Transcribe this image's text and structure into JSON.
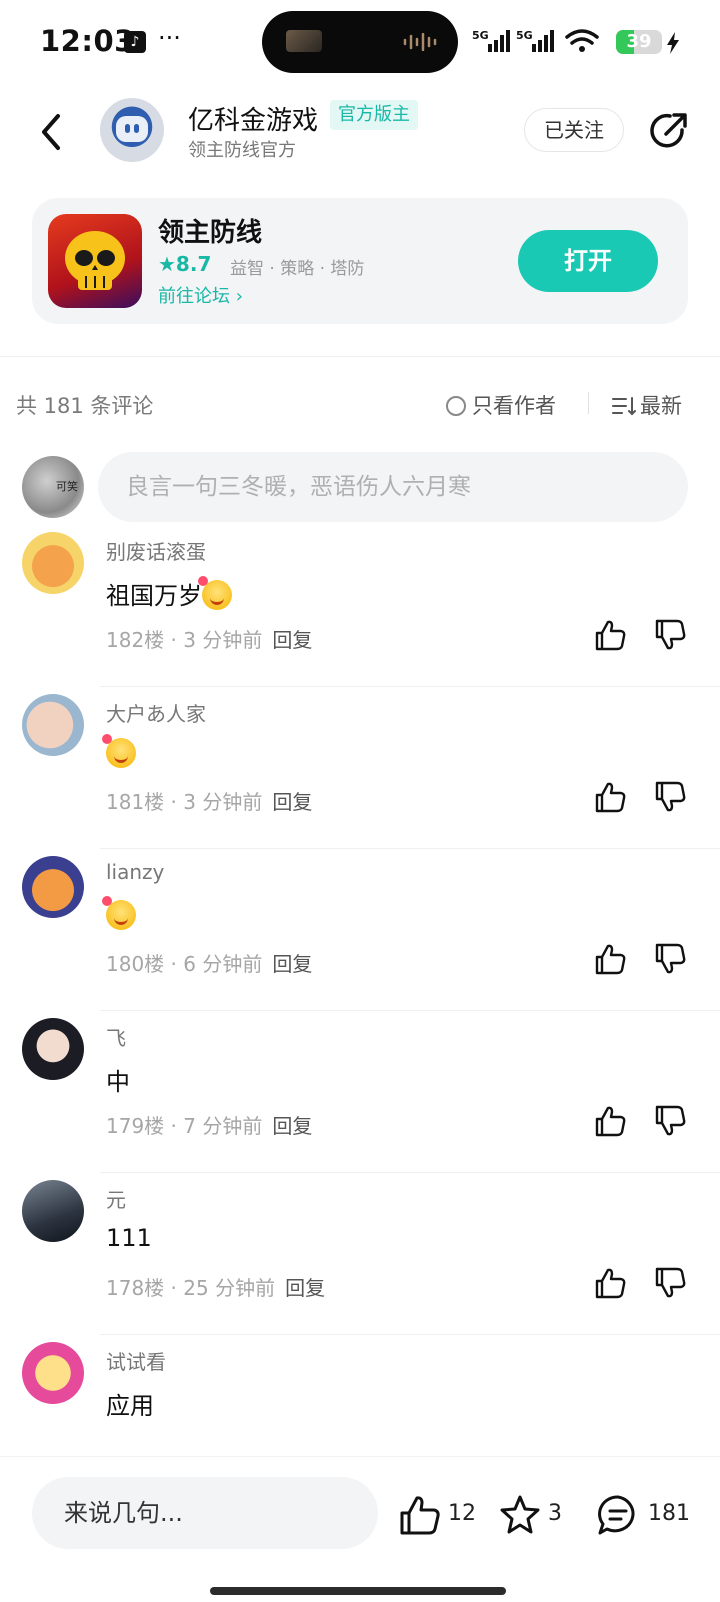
{
  "status_bar": {
    "time": "12:03",
    "more": "···",
    "network_1": "5G",
    "network_2": "5G",
    "battery": "39",
    "battery_level": 0.39
  },
  "header": {
    "author_name": "亿科金游戏",
    "badge": "官方版主",
    "author_subtitle": "领主防线官方",
    "follow_label": "已关注"
  },
  "app": {
    "name": "领主防线",
    "rating": "★8.7",
    "tags": "益智 · 策略 · 塔防",
    "forum_link": "前往论坛 ›",
    "open_label": "打开"
  },
  "comments_bar": {
    "count_label": "共 181 条评论",
    "author_only_label": "只看作者",
    "sort_label": "最新"
  },
  "comment_input": {
    "placeholder": "良言一句三冬暖，恶语伤人六月寒"
  },
  "comments": [
    {
      "name": "别废话滚蛋",
      "text": "祖国万岁",
      "floor": "182楼",
      "time": "3 分钟前",
      "reply": "回复",
      "emoji": true
    },
    {
      "name": "大户あ人家",
      "text": "",
      "floor": "181楼",
      "time": "3 分钟前",
      "reply": "回复",
      "emoji": true
    },
    {
      "name": "lianzy",
      "text": "",
      "floor": "180楼",
      "time": "6 分钟前",
      "reply": "回复",
      "emoji": true
    },
    {
      "name": "飞",
      "text": "中",
      "floor": "179楼",
      "time": "7 分钟前",
      "reply": "回复",
      "emoji": false
    },
    {
      "name": "元",
      "text": "111",
      "floor": "178楼",
      "time": "25 分钟前",
      "reply": "回复",
      "emoji": false
    },
    {
      "name": "试试看",
      "text": "应用",
      "floor": "",
      "time": "",
      "reply": "",
      "emoji": false
    }
  ],
  "bottom_bar": {
    "placeholder": "来说几句...",
    "likes": "12",
    "favorites": "3",
    "comments": "181"
  },
  "colors": {
    "accent": "#19c9b4",
    "accent_text": "#19b8a6",
    "card_bg": "#f2f4f6"
  }
}
